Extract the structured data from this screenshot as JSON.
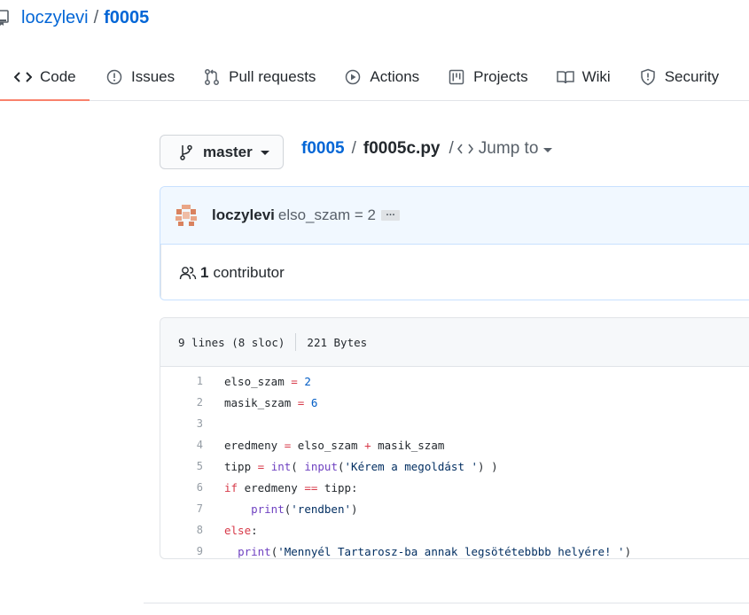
{
  "repo": {
    "owner": "loczylevi",
    "separator": "/",
    "name": "f0005",
    "icon": "repo-icon"
  },
  "nav": {
    "tabs": [
      {
        "label": "Code",
        "icon": "code-icon",
        "active": true
      },
      {
        "label": "Issues",
        "icon": "issue-opened-icon"
      },
      {
        "label": "Pull requests",
        "icon": "git-pull-request-icon"
      },
      {
        "label": "Actions",
        "icon": "play-icon"
      },
      {
        "label": "Projects",
        "icon": "project-icon"
      },
      {
        "label": "Wiki",
        "icon": "book-icon"
      },
      {
        "label": "Security",
        "icon": "shield-icon"
      }
    ]
  },
  "branch": {
    "name": "master",
    "icon": "git-branch-icon"
  },
  "breadcrumb": {
    "repo": "f0005",
    "separator": "/",
    "file": "f0005c.py",
    "separator2": "/",
    "jump_label": "Jump to"
  },
  "commit": {
    "author": "loczylevi",
    "message": "elso_szam = 2",
    "ellipsis": "…"
  },
  "contributors": {
    "count": "1",
    "label": "contributor"
  },
  "file_info": {
    "lines": "9 lines (8 sloc)",
    "size": "221 Bytes"
  },
  "code_lines": [
    "elso_szam = 2",
    "masik_szam = 6",
    "",
    "eredmeny = elso_szam + masik_szam",
    "tipp = int( input('Kérem a megoldást ') )",
    "if eredmeny == tipp:",
    "    print('rendben')",
    "else:",
    "  print('Mennyél Tartarosz-ba annak legsötétebbbb helyére! ')"
  ],
  "colors": {
    "link": "#0366d6",
    "active_tab_underline": "#f9826c",
    "keyword": "#d73a49",
    "number": "#005cc5",
    "builtin": "#6f42c1",
    "string": "#032f62"
  }
}
